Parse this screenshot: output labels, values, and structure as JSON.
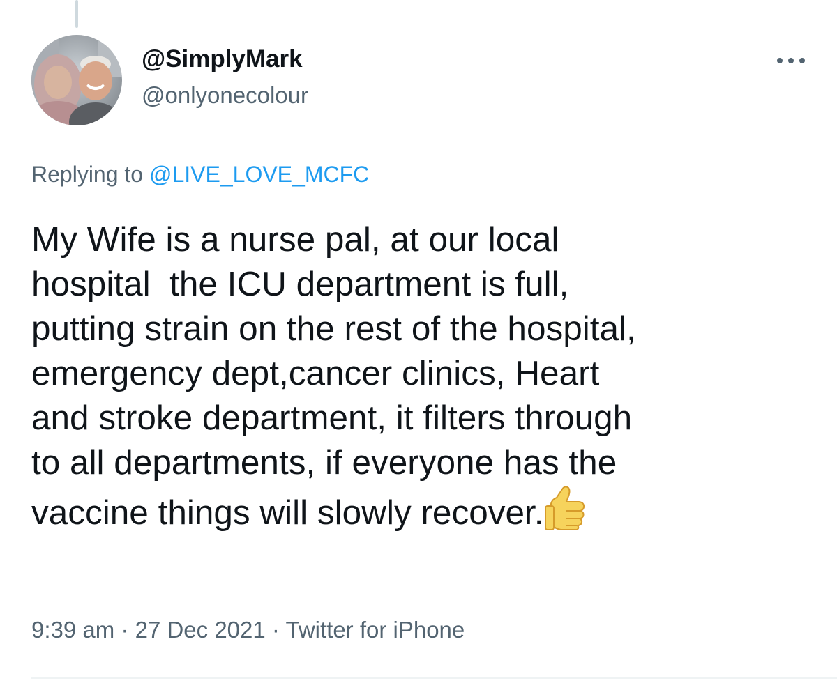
{
  "tweet": {
    "display_name": "@SimplyMark",
    "handle": "@onlyonecolour",
    "replying_prefix": "Replying to",
    "replying_to": "@LIVE_LOVE_MCFC",
    "body_lines": [
      "My Wife is a nurse pal, at our local",
      "hospital  the ICU department is full,",
      "putting strain on the rest of the hospital,",
      "emergency dept,cancer clinics, Heart",
      "and stroke department, it filters through",
      "to all departments, if everyone has the",
      "vaccine things will slowly recover."
    ],
    "emoji": "thumbs-up-icon",
    "time": "9:39 am",
    "separator": "·",
    "date": "27 Dec 2021",
    "source": "Twitter for iPhone"
  },
  "icons": {
    "more": "more-horizontal-icon",
    "avatar": "profile-photo"
  },
  "colors": {
    "text": "#0f1419",
    "secondary": "#536471",
    "link": "#1d9bf0",
    "thread_line": "#cfd9de"
  }
}
